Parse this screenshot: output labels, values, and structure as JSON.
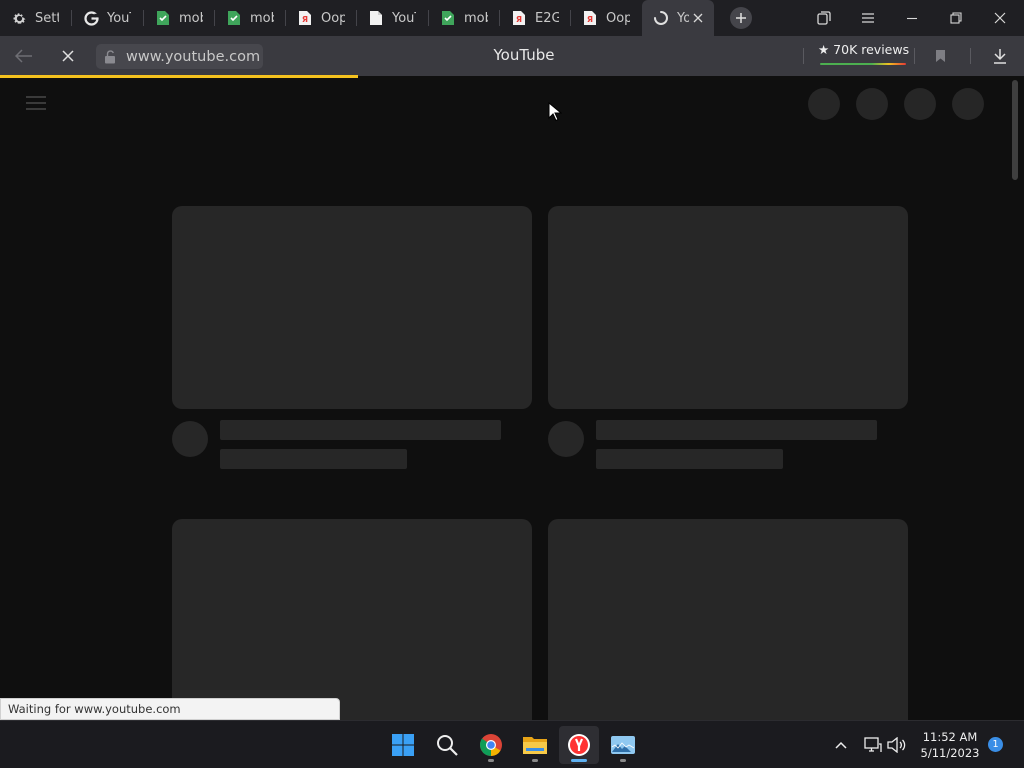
{
  "browser": {
    "tabs": [
      {
        "label": "Setti",
        "icon": "gear-icon"
      },
      {
        "label": "YouT",
        "icon": "google-icon"
      },
      {
        "label": "mob",
        "icon": "shield-icon"
      },
      {
        "label": "mob",
        "icon": "shield-icon"
      },
      {
        "label": "Oop",
        "icon": "yandex-icon"
      },
      {
        "label": "YouT",
        "icon": "document-icon"
      },
      {
        "label": "mob",
        "icon": "shield-icon"
      },
      {
        "label": "E2G",
        "icon": "yandex-icon"
      },
      {
        "label": "Oop",
        "icon": "yandex-icon"
      },
      {
        "label": "Yo",
        "icon": "loading-spinner-icon",
        "active": true
      }
    ],
    "url": "www.youtube.com",
    "page_title": "YouTube",
    "reviews_label": "★ 70K reviews",
    "status_text": "Waiting for www.youtube.com",
    "load_progress_percent": 35,
    "colors": {
      "chrome": "#3a3a40",
      "tabstrip": "#1f1f23",
      "accent_progress": "#f4c21f",
      "page_bg": "#0f0f0f",
      "skeleton": "#272727"
    }
  },
  "taskbar": {
    "apps": [
      "windows-start-icon",
      "search-icon",
      "chrome-icon",
      "file-explorer-icon",
      "yandex-browser-icon",
      "photos-icon"
    ],
    "time": "11:52 AM",
    "date": "5/11/2023",
    "notification_count": "1"
  }
}
